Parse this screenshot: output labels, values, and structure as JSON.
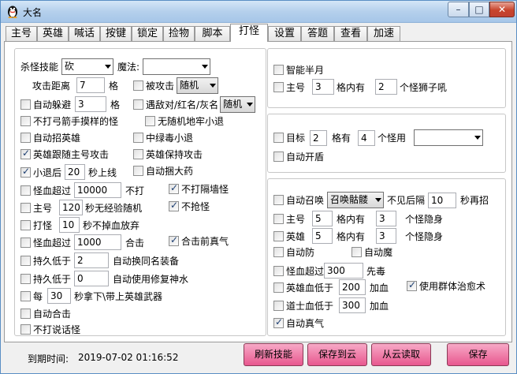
{
  "window": {
    "title": "大名",
    "min": "–",
    "max": "□",
    "close": "✕"
  },
  "tabs": [
    "主号",
    "英雄",
    "喊话",
    "按键",
    "锁定",
    "捡物",
    "脚本",
    "打怪",
    "设置",
    "答题",
    "查看",
    "加速"
  ],
  "left": {
    "skill_label": "杀怪技能",
    "skill_value": "砍",
    "magic_label": "魔法:",
    "magic_value": "",
    "dist_label": "攻击距离",
    "dist_value": "7",
    "grid": "格",
    "attacked_label": "被攻击",
    "attacked_value": "随机",
    "dodge_label": "自动躲避",
    "dodge_value": "3",
    "enemy_label": "遇敌对/红名/灰名",
    "enemy_value": "随机",
    "archer_label": "不打弓箭手摸样的怪",
    "noroll_label": "无随机地牢小退",
    "summon_hero_label": "自动招英雄",
    "poison_label": "中绿毒小退",
    "follow_label": "英雄跟随主号攻击",
    "keep_label": "英雄保持攻击",
    "smallback_a": "小退后",
    "smallback_value": "20",
    "smallback_b": "秒上线",
    "catch_label": "自动捆大药",
    "hp1_label": "怪血超过",
    "hp1_value": "10000",
    "hp1_suffix": "不打",
    "wall_label": "不打隔墙怪",
    "main_label": "主号",
    "main_value": "120",
    "main_suffix": "秒无经验随机",
    "noloot_label": "不抢怪",
    "hit_a": "打怪",
    "hit_value": "10",
    "hit_b": "秒不掉血放弃",
    "hp2_label": "怪血超过",
    "hp2_value": "1000",
    "hp2_suffix": "合击",
    "zhenqi_label": "合击前真气",
    "dur1_label": "持久低于",
    "dur1_value": "2",
    "dur1_suffix": "自动换同名装备",
    "dur2_label": "持久低于",
    "dur2_value": "0",
    "dur2_suffix": "自动使用修复神水",
    "every_a": "每",
    "every_value": "30",
    "every_b": "秒拿下\\带上英雄武器",
    "auto_combo_label": "自动合击",
    "nospeak_label": "不打说话怪"
  },
  "r1": {
    "halfmoon_label": "智能半月",
    "main_label": "主号",
    "main_value": "3",
    "mid": "格内有",
    "count_value": "2",
    "suffix": "个怪狮子吼"
  },
  "r2": {
    "target_label": "目标",
    "target_value": "2",
    "mid": "格有",
    "count_value": "4",
    "suffix": "个怪用",
    "select_value": "",
    "shield_label": "自动开盾"
  },
  "r3": {
    "summon_label": "自动召唤",
    "summon_value": "召唤骷髅",
    "notsee": "不见后隔",
    "notsee_value": "10",
    "notsee_suffix": "秒再招",
    "main_label": "主号",
    "main_value": "5",
    "mid": "格内有",
    "main_count": "3",
    "hide": "个怪隐身",
    "hero_label": "英雄",
    "hero_value": "5",
    "hero_count": "3",
    "defense_label": "自动防",
    "magic_label": "自动魔",
    "hp_label": "怪血超过",
    "hp_value": "300",
    "hp_suffix": "先毒",
    "herohp_label": "英雄血低于",
    "herohp_value": "200",
    "add_blood": "加血",
    "group_heal_label": "使用群体治愈术",
    "taoist_label": "道士血低于",
    "taoist_value": "300",
    "zhenqi_label": "自动真气"
  },
  "footer": {
    "expire_label": "到期时间:",
    "expire_value": "2019-07-02 01:16:52",
    "refresh": "刷新技能",
    "save_cloud": "保存到云",
    "load_cloud": "从云读取",
    "save": "保存"
  }
}
